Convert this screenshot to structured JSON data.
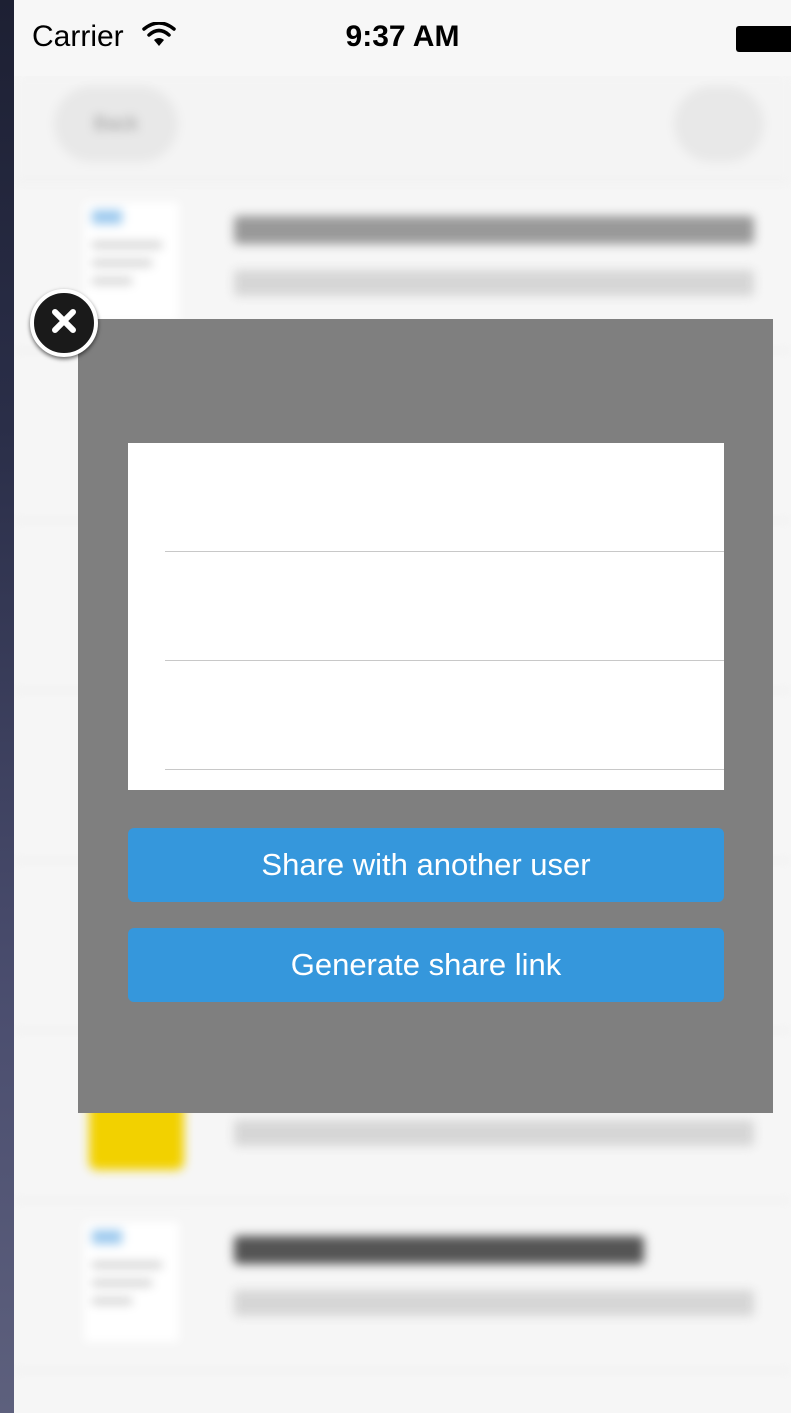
{
  "status_bar": {
    "carrier": "Carrier",
    "time": "9:37 AM",
    "wifi_icon": "wifi-icon",
    "battery_icon": "battery-icon"
  },
  "background": {
    "navbar": {
      "back_button_label": "Back",
      "add_button_icon": "plus-icon"
    },
    "files": [
      {
        "title": "",
        "thumbnail": "document-thumbnail"
      },
      {
        "title": "",
        "thumbnail": "document-thumbnail"
      },
      {
        "title": "",
        "thumbnail": "document-thumbnail"
      },
      {
        "title": "",
        "thumbnail": "document-thumbnail"
      },
      {
        "title": "",
        "thumbnail": "document-thumbnail"
      },
      {
        "title": "",
        "thumbnail": "yellow-thumbnail"
      },
      {
        "title": "",
        "thumbnail": "document-thumbnail"
      }
    ]
  },
  "share_popup": {
    "close_icon": "close-icon",
    "form_fields": [
      {
        "value": "",
        "placeholder": ""
      },
      {
        "value": "",
        "placeholder": ""
      },
      {
        "value": "",
        "placeholder": ""
      }
    ],
    "share_with_user_label": "Share with another user",
    "generate_link_label": "Generate share link"
  },
  "colors": {
    "overlay_gray": "#7f7f7f",
    "button_blue": "#3597dc"
  }
}
